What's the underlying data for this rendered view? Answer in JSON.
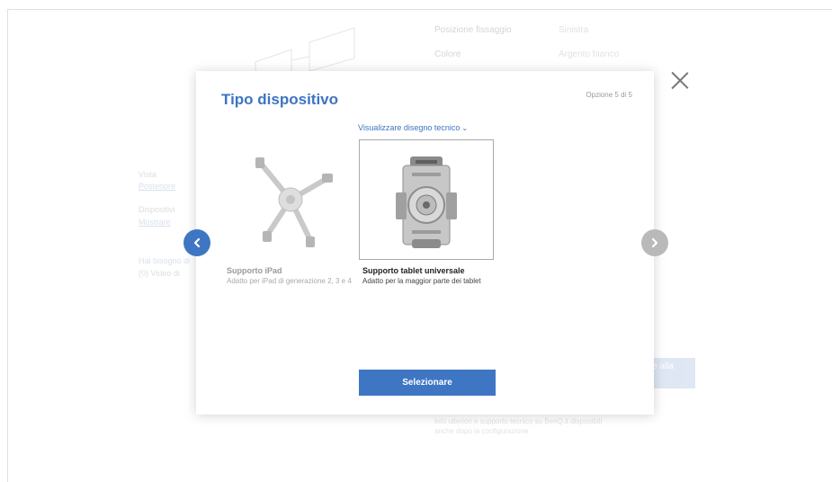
{
  "background": {
    "specs": [
      {
        "label": "Posizione fissaggio",
        "value": "Sinistra"
      },
      {
        "label": "Colore",
        "value": "Argento bianco"
      }
    ],
    "sidebar": {
      "vista_label": "Vista",
      "vista_link": "Posteriore",
      "dispositivi_label": "Dispositivi",
      "dispositivi_link": "Mostrare",
      "help_label": "Hai bisogno di",
      "help_sub": "(0) Video di"
    },
    "cta_label": "e alla",
    "note": "Info ulteriori e supporto tecnico su BenQ.it disponibili anche dopo la configurazione"
  },
  "modal": {
    "title": "Tipo dispositivo",
    "counter": "Opzione 5 di 5",
    "tech_link": "Visualizzare disegno tecnico",
    "options": [
      {
        "name": "Supporto iPad",
        "desc": "Adatto per iPad di generazione 2, 3 e 4",
        "selected": false
      },
      {
        "name": "Supporto tablet universale",
        "desc": "Adatto per la maggior parte dei tablet",
        "selected": true
      }
    ],
    "select_label": "Selezionare"
  },
  "icons": {
    "close": "close-icon",
    "prev": "chevron-left-icon",
    "next": "chevron-right-icon",
    "tech_chevron": "chevron-down-icon"
  },
  "colors": {
    "accent": "#3e76c3",
    "title": "#3d74c1",
    "disabled_arrow": "#b9b9b9"
  }
}
